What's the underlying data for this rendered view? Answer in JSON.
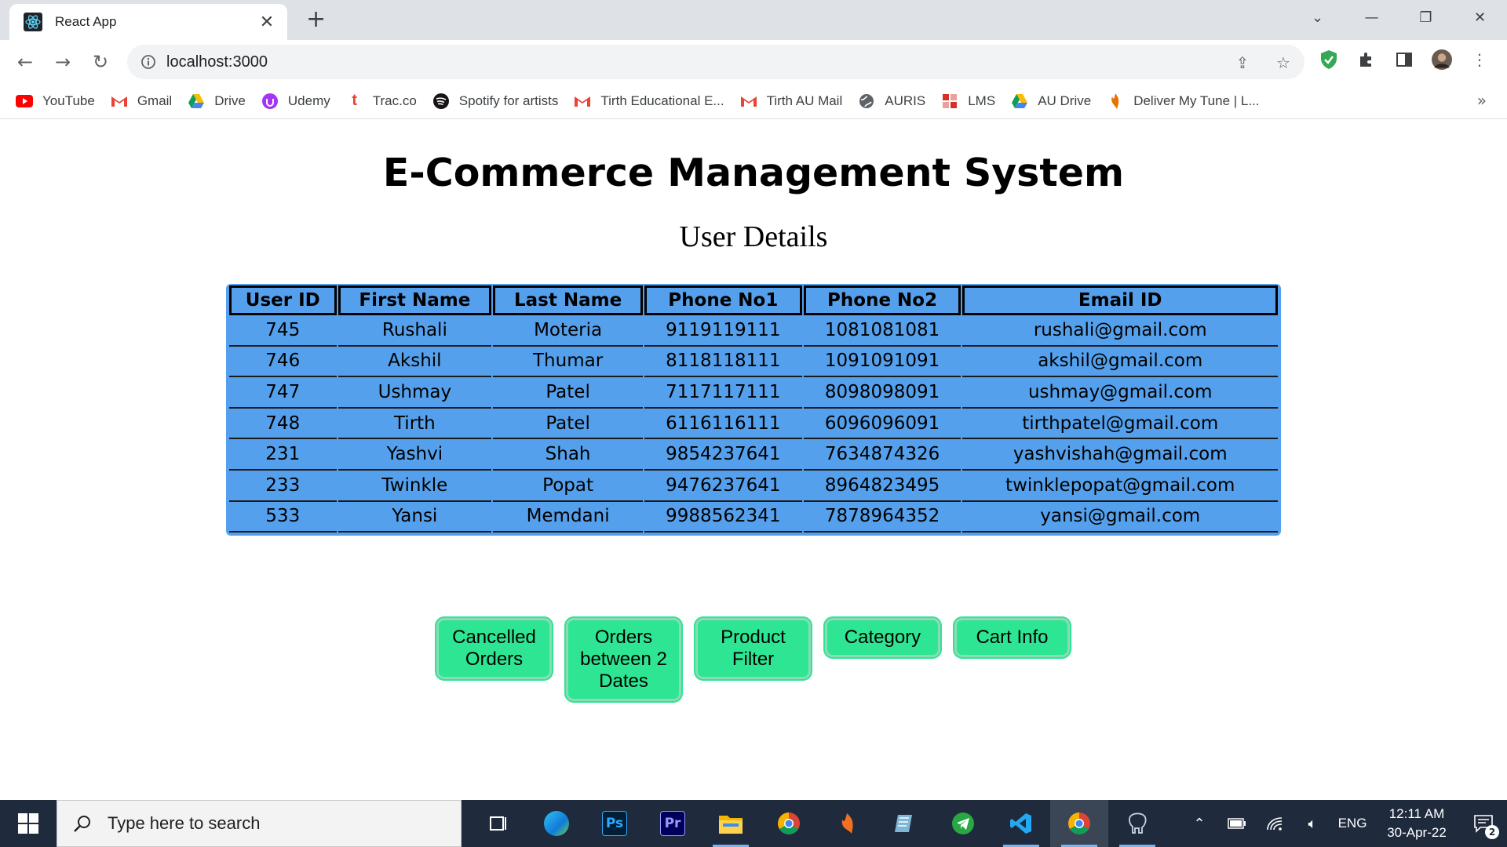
{
  "browser": {
    "tab_title": "React App",
    "url": "localhost:3000",
    "bookmarks": [
      {
        "label": "YouTube",
        "icon": "youtube-icon",
        "color": "#ff0000"
      },
      {
        "label": "Gmail",
        "icon": "gmail-icon",
        "color": "#ea4335"
      },
      {
        "label": "Drive",
        "icon": "drive-icon",
        "color": "#1fa463"
      },
      {
        "label": "Udemy",
        "icon": "udemy-icon",
        "color": "#a435f0"
      },
      {
        "label": "Trac.co",
        "icon": "trac-icon",
        "color": "#e5432d"
      },
      {
        "label": "Spotify for artists",
        "icon": "spotify-icon",
        "color": "#191414"
      },
      {
        "label": "Tirth Educational E...",
        "icon": "gmail-icon",
        "color": "#ea4335"
      },
      {
        "label": "Tirth AU Mail",
        "icon": "gmail-icon",
        "color": "#ea4335"
      },
      {
        "label": "AURIS",
        "icon": "globe-icon",
        "color": "#5f6368"
      },
      {
        "label": "LMS",
        "icon": "lms-icon",
        "color": "#d93025"
      },
      {
        "label": "AU Drive",
        "icon": "drive-icon",
        "color": "#1fa463"
      },
      {
        "label": "Deliver My Tune | L...",
        "icon": "deliver-my-tune-icon",
        "color": "#e37400"
      }
    ]
  },
  "page": {
    "title": "E-Commerce Management System",
    "subtitle": "User Details",
    "table": {
      "headers": [
        "User ID",
        "First Name",
        "Last Name",
        "Phone No1",
        "Phone No2",
        "Email ID"
      ],
      "rows": [
        [
          "745",
          "Rushali",
          "Moteria",
          "9119119111",
          "1081081081",
          "rushali@gmail.com"
        ],
        [
          "746",
          "Akshil",
          "Thumar",
          "8118118111",
          "1091091091",
          "akshil@gmail.com"
        ],
        [
          "747",
          "Ushmay",
          "Patel",
          "7117117111",
          "8098098091",
          "ushmay@gmail.com"
        ],
        [
          "748",
          "Tirth",
          "Patel",
          "6116116111",
          "6096096091",
          "tirthpatel@gmail.com"
        ],
        [
          "231",
          "Yashvi",
          "Shah",
          "9854237641",
          "7634874326",
          "yashvishah@gmail.com"
        ],
        [
          "233",
          "Twinkle",
          "Popat",
          "9476237641",
          "8964823495",
          "twinklepopat@gmail.com"
        ],
        [
          "533",
          "Yansi",
          "Memdani",
          "9988562341",
          "7878964352",
          "yansi@gmail.com"
        ]
      ]
    },
    "buttons": [
      "Cancelled Orders",
      "Orders between 2 Dates",
      "Product Filter",
      "Category",
      "Cart Info"
    ]
  },
  "taskbar": {
    "search_placeholder": "Type here to search",
    "apps": [
      {
        "name": "task-view-icon",
        "label": "",
        "color": "#1f2a3c"
      },
      {
        "name": "edge-icon",
        "label": "",
        "color": "#0f7bd8"
      },
      {
        "name": "photoshop-icon",
        "label": "Ps",
        "color": "#001e36"
      },
      {
        "name": "premiere-icon",
        "label": "Pr",
        "color": "#00005b"
      },
      {
        "name": "file-explorer-icon",
        "label": "",
        "color": "#f2b600"
      },
      {
        "name": "chrome-icon",
        "label": "",
        "color": "#1f2a3c"
      },
      {
        "name": "fl-studio-icon",
        "label": "",
        "color": "#f37021"
      },
      {
        "name": "notes-icon",
        "label": "",
        "color": "#7fb6d6"
      },
      {
        "name": "telegram-icon",
        "label": "",
        "color": "#28a745"
      },
      {
        "name": "vscode-icon",
        "label": "",
        "color": "#1f2a3c"
      },
      {
        "name": "chrome-active-icon",
        "label": "",
        "color": "#1f2a3c"
      },
      {
        "name": "postgres-icon",
        "label": "",
        "color": "#1f2a3c"
      }
    ],
    "language": "ENG",
    "time": "12:11 AM",
    "date": "30-Apr-22",
    "notification_count": "2"
  }
}
